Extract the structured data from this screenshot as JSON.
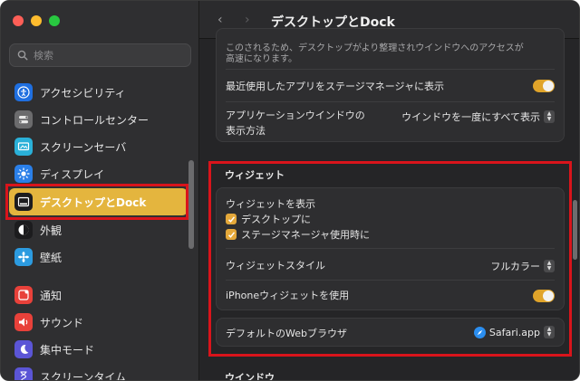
{
  "window": {
    "title": "デスクトップとDock"
  },
  "search": {
    "placeholder": "検索"
  },
  "sidebar": {
    "items": [
      {
        "label": "アクセシビリティ",
        "icon": "accessibility-icon",
        "color": "#1f6fe0"
      },
      {
        "label": "コントロールセンター",
        "icon": "control-center-icon",
        "color": "#6b6b6d"
      },
      {
        "label": "スクリーンセーバ",
        "icon": "screensaver-icon",
        "color": "#2ab0d8"
      },
      {
        "label": "ディスプレイ",
        "icon": "display-icon",
        "color": "#2a7fe8"
      },
      {
        "label": "デスクトップとDock",
        "icon": "dock-icon",
        "color": "#1c1c1e",
        "active": true
      },
      {
        "label": "外観",
        "icon": "appearance-icon",
        "color": "#1c1c1e"
      },
      {
        "label": "壁紙",
        "icon": "wallpaper-icon",
        "color": "#2c9be0"
      },
      {
        "label": "通知",
        "icon": "notifications-icon",
        "color": "#e8413a"
      },
      {
        "label": "サウンド",
        "icon": "sound-icon",
        "color": "#e8413a"
      },
      {
        "label": "集中モード",
        "icon": "focus-icon",
        "color": "#5b55d6"
      },
      {
        "label": "スクリーンタイム",
        "icon": "screen-time-icon",
        "color": "#5b55d6"
      }
    ]
  },
  "main": {
    "top_text_line1": "このされるため、デスクトップがより整理されウインドウへのアクセスが",
    "top_text_line2": "高速になります。",
    "recent_apps_label": "最近使用したアプリをステージマネージャに表示",
    "app_windows_label_line1": "アプリケーションウインドウの",
    "app_windows_label_line2": "表示方法",
    "app_windows_value": "ウインドウを一度にすべて表示",
    "widgets_section": "ウィジェット",
    "show_widgets_label": "ウィジェットを表示",
    "checkbox_desktop": "デスクトップに",
    "checkbox_stage_manager": "ステージマネージャ使用時に",
    "widget_style_label": "ウィジェットスタイル",
    "widget_style_value": "フルカラー",
    "iphone_widgets_label": "iPhoneウィジェットを使用",
    "default_browser_label": "デフォルトのWebブラウザ",
    "default_browser_value": "Safari.app",
    "windows_section": "ウインドウ"
  },
  "colors": {
    "accent": "#e4b53e",
    "highlight_box": "#d9141b",
    "toggle_on": "#e0a42a"
  }
}
